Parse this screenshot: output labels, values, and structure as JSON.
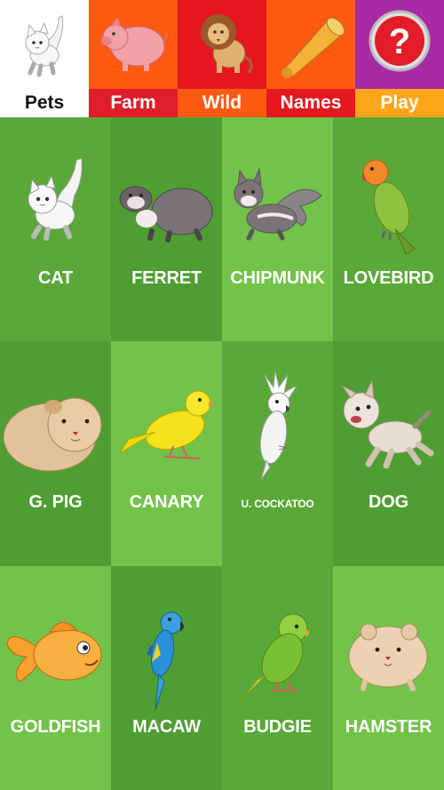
{
  "tabs": [
    {
      "label": "Pets",
      "bg": "#ffffff",
      "strip": "#ffffff",
      "icon": "cat-icon",
      "active": true
    },
    {
      "label": "Farm",
      "bg": "#ff5a12",
      "strip": "#e01d2a",
      "icon": "pig-icon",
      "active": false
    },
    {
      "label": "Wild",
      "bg": "#e4171f",
      "strip": "#ff5a12",
      "icon": "lion-icon",
      "active": false
    },
    {
      "label": "Names",
      "bg": "#ff5a12",
      "strip": "#e4171f",
      "icon": "megaphone-icon",
      "active": false
    },
    {
      "label": "Play",
      "bg": "#a52aa4",
      "strip": "#ffa51c",
      "icon": "question-icon",
      "active": false
    }
  ],
  "animals": [
    {
      "name": "CAT",
      "icon": "cat-icon",
      "bg": "#5aa838"
    },
    {
      "name": "FERRET",
      "icon": "ferret-icon",
      "bg": "#4f9e33"
    },
    {
      "name": "CHIPMUNK",
      "icon": "chipmunk-icon",
      "bg": "#73c24a"
    },
    {
      "name": "LOVEBIRD",
      "icon": "lovebird-icon",
      "bg": "#5aa838"
    },
    {
      "name": "G. PIG",
      "icon": "guinea-pig-icon",
      "bg": "#4f9e33"
    },
    {
      "name": "CANARY",
      "icon": "canary-icon",
      "bg": "#73c24a"
    },
    {
      "name": "U. COCKATOO",
      "icon": "cockatoo-icon",
      "bg": "#5aa838"
    },
    {
      "name": "DOG",
      "icon": "dog-icon",
      "bg": "#4f9e33"
    },
    {
      "name": "GOLDFISH",
      "icon": "goldfish-icon",
      "bg": "#73c24a"
    },
    {
      "name": "MACAW",
      "icon": "macaw-icon",
      "bg": "#4f9e33"
    },
    {
      "name": "BUDGIE",
      "icon": "budgie-icon",
      "bg": "#5aa838"
    },
    {
      "name": "HAMSTER",
      "icon": "hamster-icon",
      "bg": "#73c24a"
    }
  ]
}
